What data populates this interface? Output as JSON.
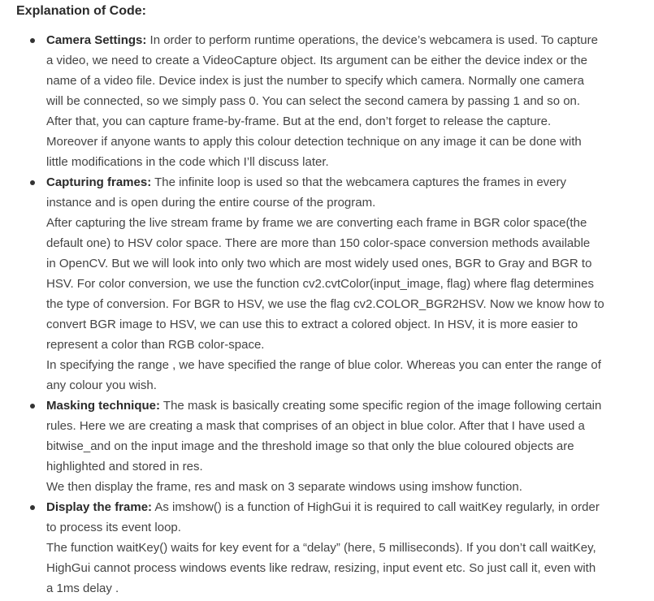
{
  "heading": "Explanation of Code:",
  "items": [
    {
      "term": "Camera Settings:",
      "lines": [
        " In order to perform runtime operations, the device’s webcamera is used. To capture",
        "a video, we need to create a VideoCapture object. Its argument can be either the device index or the",
        "name of a video file. Device index is just the number to specify which camera. Normally one camera",
        "will be connected, so we simply pass 0. You can select the second camera by passing 1 and so on.",
        "After that, you can capture frame-by-frame. But at the end, don’t forget to release the capture.",
        "Moreover if anyone wants to apply this colour detection technique on any image it can be done with",
        "little modifications in the code which I’ll discuss later."
      ]
    },
    {
      "term": "Capturing frames:",
      "lines": [
        " The infinite loop is used so that the webcamera captures the frames in every",
        "instance and is open during the entire course of the program.",
        "After capturing the live stream frame by frame we are converting each frame in BGR color space(the",
        "default one) to HSV color space. There are more than 150 color-space conversion methods available",
        "in OpenCV. But we will look into only two which are most widely used ones, BGR to Gray and BGR to",
        "HSV. For color conversion, we use the function cv2.cvtColor(input_image, flag) where flag determines",
        "the type of conversion. For BGR to HSV, we use the flag cv2.COLOR_BGR2HSV. Now we know how to",
        "convert BGR image to HSV, we can use this to extract a colored object. In HSV, it is more easier to",
        "represent a color than RGB color-space.",
        "In specifying the range , we have specified the range of blue color. Whereas you can enter the range of",
        "any colour you wish."
      ]
    },
    {
      "term": "Masking technique:",
      "lines": [
        " The mask is basically creating some specific region of the image following certain",
        "rules. Here we are creating a mask that comprises of an object in blue color. After that I have used a",
        "bitwise_and on the input image and the threshold image so that only the blue coloured objects are",
        "highlighted and stored in res.",
        "We then display the frame, res and mask on 3 separate windows using imshow function."
      ]
    },
    {
      "term": "Display the frame:",
      "lines": [
        " As imshow() is a function of HighGui it is required to call waitKey regularly, in order",
        "to process its event loop.",
        "The function waitKey() waits for key event for a “delay” (here, 5 milliseconds). If you don’t call waitKey,",
        "HighGui cannot process windows events like redraw, resizing, input event etc. So just call it, even with",
        "a 1ms delay ."
      ]
    }
  ]
}
